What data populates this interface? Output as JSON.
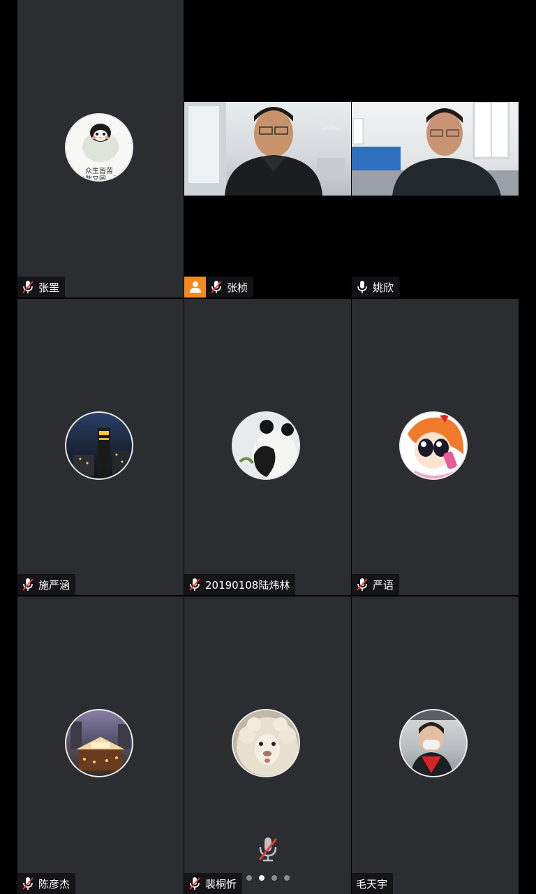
{
  "participants": [
    {
      "name": "张罜",
      "muted": true
    },
    {
      "name": "张桢",
      "muted": true,
      "host": true
    },
    {
      "name": "姚欣",
      "muted": false
    },
    {
      "name": "施严涵",
      "muted": true
    },
    {
      "name": "20190108陆炜林",
      "muted": true
    },
    {
      "name": "严语",
      "muted": true
    },
    {
      "name": "陈彦杰",
      "muted": true
    },
    {
      "name": "裴桐忻",
      "muted": true
    },
    {
      "name": "毛天宇",
      "muted": false
    }
  ],
  "avatar_penguin_text": {
    "line1": "众生皆苦",
    "line2": "又胖又圆，吾"
  },
  "pagination": {
    "pages": 4,
    "current": 2
  },
  "colors": {
    "tile": "#2b2d30",
    "label_bg": "#141416",
    "host_badge": "#f38a1f",
    "muted_slash": "#e23b3b"
  }
}
